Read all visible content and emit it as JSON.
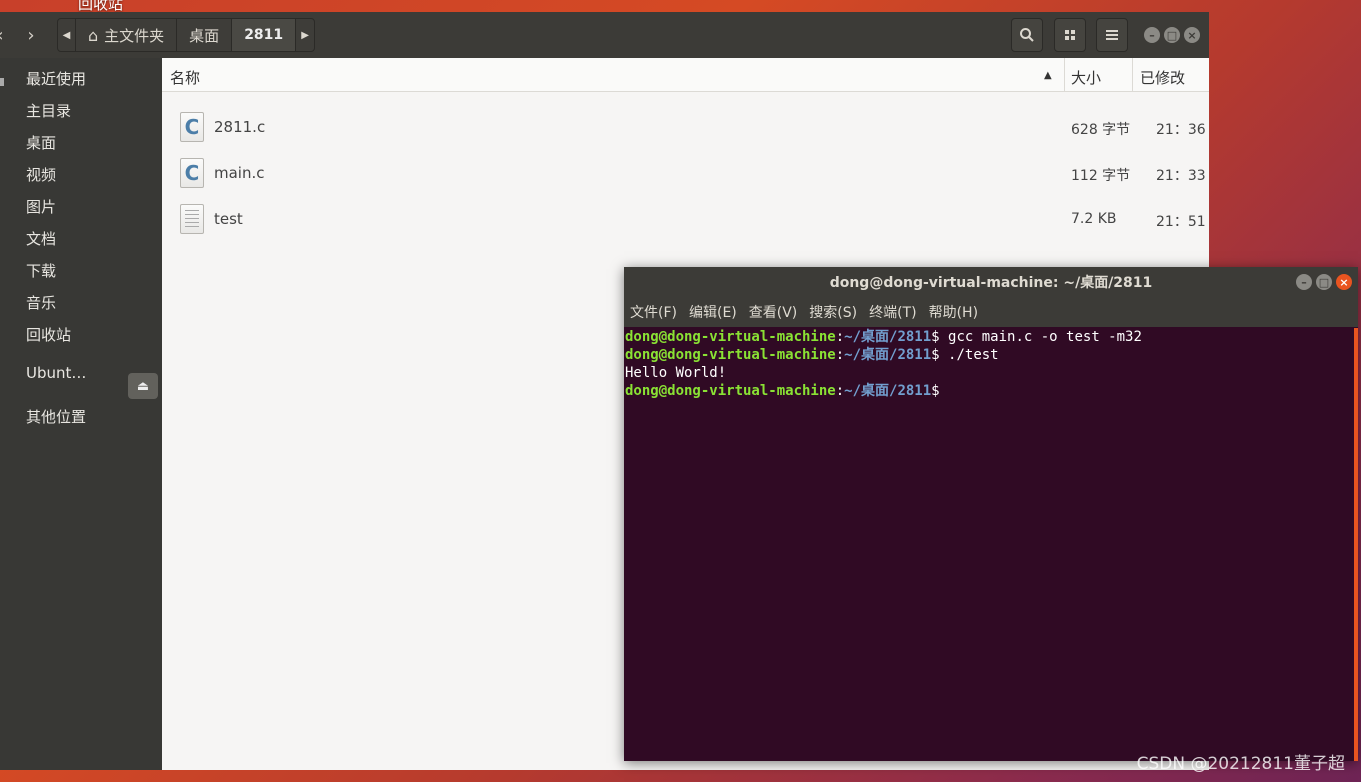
{
  "desktop": {
    "trash_label": "回收站",
    "watermark": "CSDN @20212811董子超"
  },
  "file_manager": {
    "breadcrumbs": [
      "主文件夹",
      "桌面",
      "2811"
    ],
    "sidebar": {
      "items": [
        "最近使用",
        "主目录",
        "桌面",
        "视频",
        "图片",
        "文档",
        "下载",
        "音乐",
        "回收站"
      ],
      "device": "Ubunt…",
      "other": "其他位置"
    },
    "columns": {
      "name": "名称",
      "size": "大小",
      "modified": "已修改"
    },
    "files": [
      {
        "name": "2811.c",
        "size": "628 字节",
        "time": "21：36",
        "icon": "c-source-file-icon"
      },
      {
        "name": "main.c",
        "size": "112 字节",
        "time": "21：33",
        "icon": "c-source-file-icon"
      },
      {
        "name": "test",
        "size": "7.2 KB",
        "time": "21：51",
        "icon": "text-file-icon"
      }
    ]
  },
  "terminal": {
    "title": "dong@dong-virtual-machine: ~/桌面/2811",
    "menu": [
      "文件(F)",
      "编辑(E)",
      "查看(V)",
      "搜索(S)",
      "终端(T)",
      "帮助(H)"
    ],
    "prompt_user": "dong@dong-virtual-machine",
    "prompt_path": "~/桌面/2811",
    "lines": [
      {
        "type": "prompt",
        "cmd": " gcc main.c -o test -m32"
      },
      {
        "type": "prompt",
        "cmd": " ./test"
      },
      {
        "type": "output",
        "text": "Hello World!"
      },
      {
        "type": "prompt",
        "cmd": ""
      }
    ]
  }
}
